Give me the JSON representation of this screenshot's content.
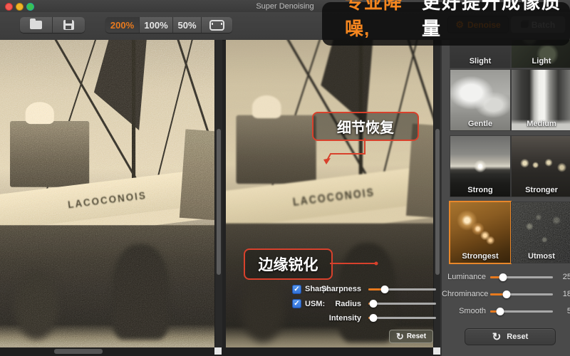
{
  "window": {
    "title": "Super Denoising"
  },
  "toolbar": {
    "zoom_200": "200%",
    "zoom_100": "100%",
    "zoom_50": "50%"
  },
  "promo_banner": {
    "highlight": "专业降噪,",
    "text": "更好提升成像质量"
  },
  "header_actions": {
    "denoise_label": "Denoise",
    "denoise_icon": "⚙",
    "batch_label": "Batch"
  },
  "scene": {
    "boat_name": "LACOCONOIS"
  },
  "annotations": {
    "detail_recovery": "细节恢复",
    "edge_sharpen": "边缘锐化"
  },
  "sharpen_controls": {
    "sharp_label": "Sharp:",
    "usm_label": "USM:",
    "check_glyph": "✓",
    "sliders": [
      {
        "label": "Sharpness",
        "pct": 24
      },
      {
        "label": "Radius",
        "pct": 7
      },
      {
        "label": "Intensity",
        "pct": 7
      }
    ],
    "reset_label": "Reset",
    "reset_icon": "↻"
  },
  "sidebar": {
    "presets": [
      {
        "label": "Slight",
        "selected": false
      },
      {
        "label": "Light",
        "selected": false
      },
      {
        "label": "Gentle",
        "selected": false
      },
      {
        "label": "Medium",
        "selected": false
      },
      {
        "label": "Strong",
        "selected": false
      },
      {
        "label": "Stronger",
        "selected": false
      },
      {
        "label": "Strongest",
        "selected": true
      },
      {
        "label": "Utmost",
        "selected": false
      }
    ],
    "sliders": [
      {
        "label": "Luminance",
        "value": "25",
        "pct": 20
      },
      {
        "label": "Chrominance",
        "value": "18",
        "pct": 26
      },
      {
        "label": "Smooth",
        "value": "5",
        "pct": 16
      }
    ],
    "reset_label": "Reset",
    "reset_icon": "↻"
  },
  "colors": {
    "accent_orange": "#f5861f",
    "annotation_red": "#d8412c",
    "selection_border": "#e8872a",
    "checkbox_blue": "#3a7de0"
  }
}
